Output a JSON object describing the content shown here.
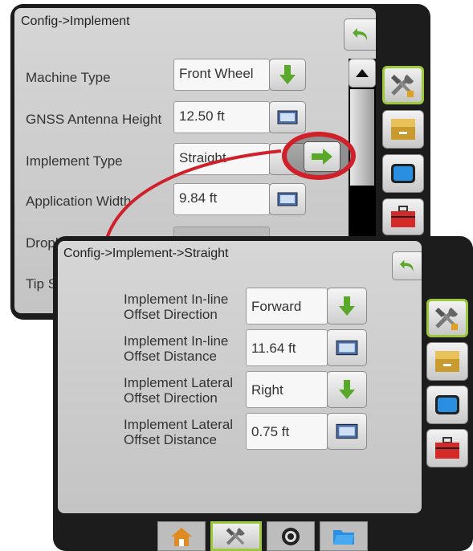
{
  "back_screen": {
    "title": "Config->Implement",
    "rows": [
      {
        "label": "Machine Type",
        "value": "Front Wheel",
        "control": "dropdown"
      },
      {
        "label": "GNSS Antenna Height",
        "value": "12.50 ft",
        "control": "keyboard"
      },
      {
        "label": "Implement Type",
        "value": "Straight",
        "control": "next"
      },
      {
        "label": "Application Width",
        "value": "9.84 ft",
        "control": "keyboard"
      },
      {
        "label": "Droplet Size Monitor",
        "value": "",
        "control": "toggle"
      },
      {
        "label": "Tip S",
        "value": "",
        "control": "none"
      }
    ]
  },
  "front_screen": {
    "title": "Config->Implement->Straight",
    "rows": [
      {
        "label_line1": "Implement In-line",
        "label_line2": "Offset Direction",
        "value": "Forward",
        "control": "dropdown"
      },
      {
        "label_line1": "Implement In-line",
        "label_line2": "Offset Distance",
        "value": "11.64 ft",
        "control": "keyboard"
      },
      {
        "label_line1": "Implement Lateral",
        "label_line2": "Offset Direction",
        "value": "Right",
        "control": "dropdown"
      },
      {
        "label_line1": "Implement Lateral",
        "label_line2": "Offset Distance",
        "value": "0.75 ft",
        "control": "keyboard"
      }
    ],
    "bottom_tabs": [
      "home-icon",
      "tools-icon",
      "camera-icon",
      "folder-icon"
    ]
  },
  "side_tabs": [
    "tools-icon",
    "console-icon",
    "screen-icon",
    "toolbox-icon"
  ],
  "colors": {
    "accent_green": "#9cc83a",
    "arrow_green": "#5aa82a",
    "callout_red": "#d0202a",
    "panel": "#1c1c1c"
  }
}
